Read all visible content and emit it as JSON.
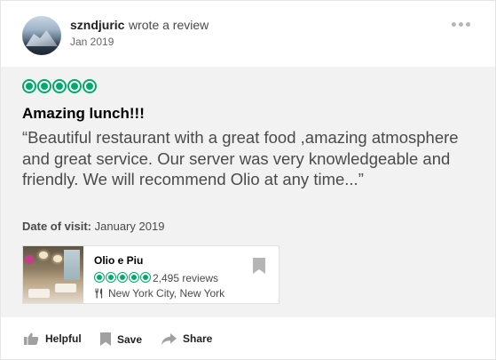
{
  "review": {
    "username": "szndjuric",
    "action_text": "wrote a review",
    "date": "Jan 2019",
    "rating": 5,
    "title": "Amazing lunch!!!",
    "text": "“Beautiful restaurant with a great food ,amazing atmosphere and great service. Our server was very knowledgeable and friendly. We will recommend Olio at any time...”",
    "visit_label": "Date of visit:",
    "visit_value": "January 2019"
  },
  "restaurant": {
    "name": "Olio e Piu",
    "rating": 5,
    "reviews": "2,495 reviews",
    "location": "New York City, New York"
  },
  "actions": {
    "helpful": "Helpful",
    "save": "Save",
    "share": "Share"
  },
  "colors": {
    "accent": "#00aa6c",
    "body_bg": "#f2f2f2",
    "text_muted": "#4a4a4a"
  },
  "icons": [
    "more-icon",
    "bookmark-icon",
    "utensils-icon",
    "thumbs-up-icon",
    "save-icon",
    "share-icon"
  ]
}
